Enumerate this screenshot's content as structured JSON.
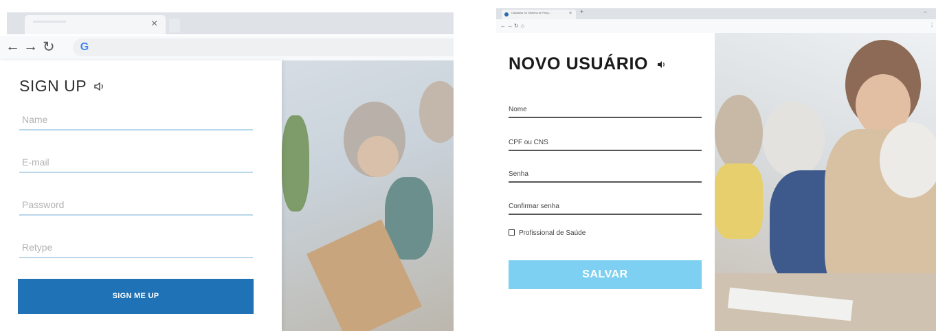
{
  "left": {
    "browser": {
      "tab_close": "×",
      "back": "←",
      "forward": "→",
      "reload": "↻",
      "google_glyph": "G"
    },
    "form": {
      "title": "SIGN UP",
      "fields": [
        {
          "placeholder": "Name"
        },
        {
          "placeholder": "E-mail"
        },
        {
          "placeholder": "Password"
        },
        {
          "placeholder": "Retype"
        }
      ],
      "submit_label": "SIGN ME UP"
    },
    "colors": {
      "button": "#1e72b5",
      "field_underline": "#b9d6ea"
    }
  },
  "right": {
    "browser": {
      "tab_title": "Cadastrar no Sistema de Pesq...",
      "tab_close": "×",
      "new_tab": "+",
      "minimize": "–",
      "back": "←",
      "forward": "→",
      "reload": "↻",
      "home": "⌂",
      "menu": "⋮"
    },
    "form": {
      "title": "NOVO USUÁRIO",
      "fields": [
        {
          "label": "Nome"
        },
        {
          "label": "CPF ou CNS"
        },
        {
          "label": "Senha"
        },
        {
          "label": "Confirmar senha"
        }
      ],
      "checkbox_label": "Profissional de Saúde",
      "checkbox_checked": false,
      "submit_label": "SALVAR"
    },
    "colors": {
      "button": "#7dd0f1",
      "field_underline": "#555555"
    }
  }
}
